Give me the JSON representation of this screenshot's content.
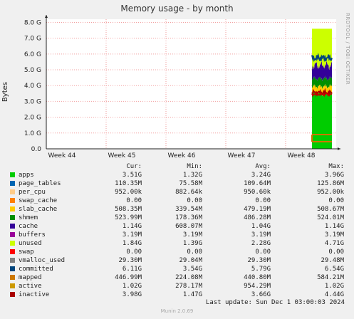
{
  "chart_data": {
    "type": "area",
    "title": "Memory usage - by month",
    "ylabel": "Bytes",
    "side_label": "RRDTOOL / TOBI OETIKER",
    "ylim": [
      0,
      8.2
    ],
    "y_ticks": [
      "0.0",
      "1.0 G",
      "2.0 G",
      "3.0 G",
      "4.0 G",
      "5.0 G",
      "6.0 G",
      "7.0 G",
      "8.0 G"
    ],
    "x_ticks": [
      "Week 44",
      "Week 45",
      "Week 46",
      "Week 47",
      "Week 48"
    ],
    "grid": true,
    "colors": {
      "grid": "#f2a0a0",
      "axis": "#222222",
      "plot_bg": "#ffffff",
      "apps": "#00cc00",
      "unused": "#ccff00",
      "cache": "#330099",
      "committed": "#00457c",
      "swap": "#cc0000",
      "active": "#cc7700",
      "mapped": "#cc7700"
    },
    "note_values_in_G": true,
    "data_window_week": "Week 48",
    "stack_latest_G": {
      "apps": 3.51,
      "page_tables": 0.11,
      "per_cpu": 0.001,
      "slab_cache": 0.51,
      "shmem": 0.52,
      "cache": 1.14,
      "buffers": 0.003,
      "unused": 1.84,
      "total_top": 7.6
    }
  },
  "legend": {
    "headers": {
      "cur": "Cur:",
      "min": "Min:",
      "avg": "Avg:",
      "max": "Max:"
    },
    "rows": [
      {
        "name": "apps",
        "color": "#00cc00",
        "cur": "3.51G",
        "min": "1.32G",
        "avg": "3.24G",
        "max": "3.96G"
      },
      {
        "name": "page_tables",
        "color": "#0066b3",
        "cur": "110.35M",
        "min": "75.58M",
        "avg": "109.64M",
        "max": "125.86M"
      },
      {
        "name": "per_cpu",
        "color": "#ffcc88",
        "cur": "952.00k",
        "min": "882.64k",
        "avg": "950.60k",
        "max": "952.00k"
      },
      {
        "name": "swap_cache",
        "color": "#ff8000",
        "cur": "0.00",
        "min": "0.00",
        "avg": "0.00",
        "max": "0.00"
      },
      {
        "name": "slab_cache",
        "color": "#ffcc00",
        "cur": "508.35M",
        "min": "339.54M",
        "avg": "479.19M",
        "max": "508.67M"
      },
      {
        "name": "shmem",
        "color": "#008f00",
        "cur": "523.99M",
        "min": "178.36M",
        "avg": "486.28M",
        "max": "524.01M"
      },
      {
        "name": "cache",
        "color": "#330099",
        "cur": "1.14G",
        "min": "608.07M",
        "avg": "1.04G",
        "max": "1.14G"
      },
      {
        "name": "buffers",
        "color": "#990099",
        "cur": "3.19M",
        "min": "3.19M",
        "avg": "3.19M",
        "max": "3.19M"
      },
      {
        "name": "unused",
        "color": "#ccff00",
        "cur": "1.84G",
        "min": "1.39G",
        "avg": "2.28G",
        "max": "4.71G"
      },
      {
        "name": "swap",
        "color": "#ff0000",
        "cur": "0.00",
        "min": "0.00",
        "avg": "0.00",
        "max": "0.00"
      },
      {
        "name": "vmalloc_used",
        "color": "#808080",
        "cur": "29.30M",
        "min": "29.04M",
        "avg": "29.30M",
        "max": "29.48M"
      },
      {
        "name": "committed",
        "color": "#00457c",
        "cur": "6.11G",
        "min": "3.54G",
        "avg": "5.79G",
        "max": "6.54G"
      },
      {
        "name": "mapped",
        "color": "#cc7700",
        "cur": "446.99M",
        "min": "224.08M",
        "avg": "440.80M",
        "max": "584.21M"
      },
      {
        "name": "active",
        "color": "#cc9900",
        "cur": "1.02G",
        "min": "278.17M",
        "avg": "954.29M",
        "max": "1.02G"
      },
      {
        "name": "inactive",
        "color": "#aa0000",
        "cur": "3.98G",
        "min": "1.47G",
        "avg": "3.66G",
        "max": "4.44G"
      }
    ]
  },
  "last_update": "Last update: Sun Dec  1 03:00:03 2024",
  "footer": "Munin 2.0.69"
}
